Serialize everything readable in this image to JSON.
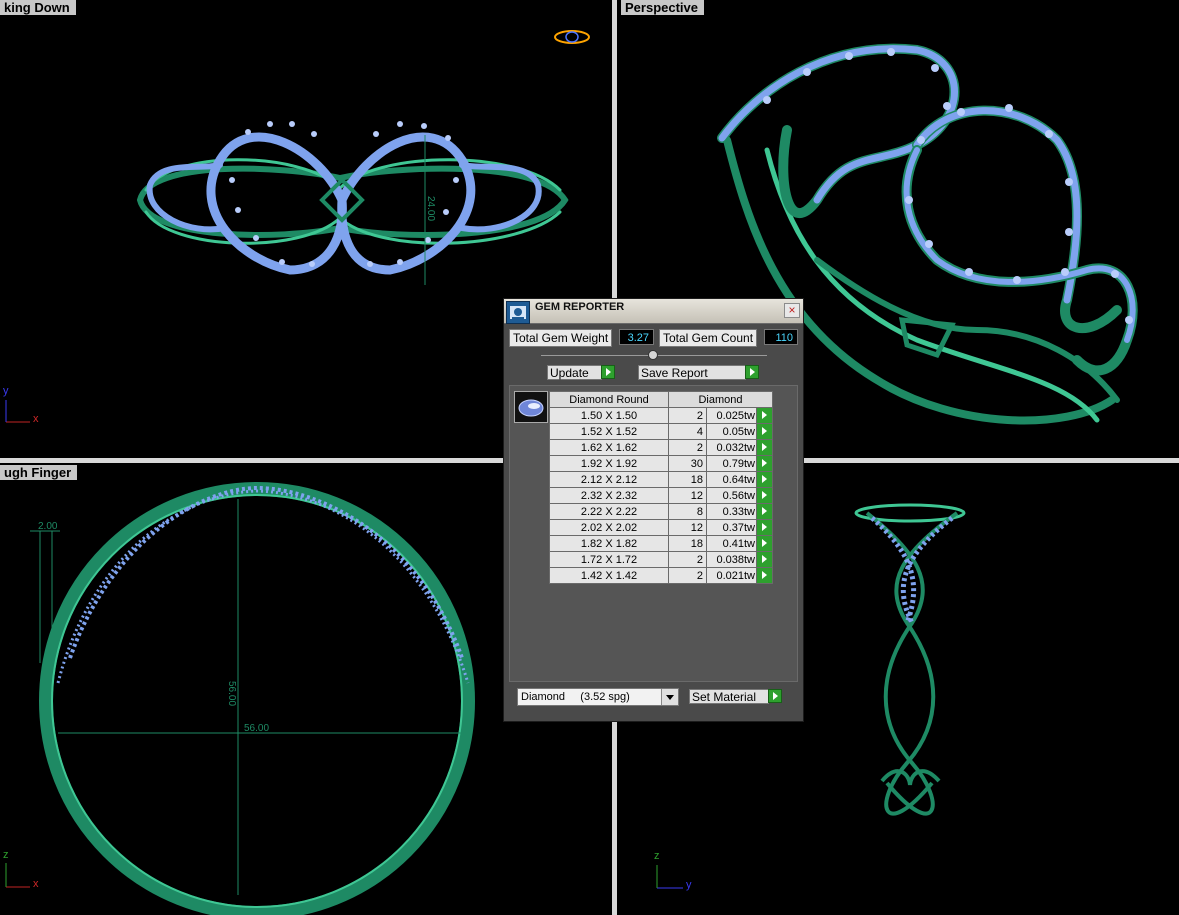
{
  "viewports": {
    "top_left_label": "king Down",
    "top_right_label": "Perspective",
    "bottom_left_label": "ugh Finger",
    "top_left_dim": "24.00",
    "bottom_left_dim_width": "2.00",
    "bottom_left_dim_height": "56.00",
    "bottom_left_dim_diameter": "56.00",
    "axes": {
      "x": "x",
      "y": "y",
      "z": "z"
    }
  },
  "gem_reporter": {
    "title": "GEM REPORTER",
    "close": "×",
    "total_weight_label": "Total Gem Weight",
    "total_weight_value": "3.27",
    "total_count_label": "Total Gem Count",
    "total_count_value": "110",
    "update_label": "Update",
    "save_report_label": "Save Report",
    "table_header_shape": "Diamond Round",
    "table_header_material": "Diamond",
    "rows": [
      {
        "size": "1.50 X 1.50",
        "count": "2",
        "weight": "0.025tw"
      },
      {
        "size": "1.52 X 1.52",
        "count": "4",
        "weight": "0.05tw"
      },
      {
        "size": "1.62 X 1.62",
        "count": "2",
        "weight": "0.032tw"
      },
      {
        "size": "1.92 X 1.92",
        "count": "30",
        "weight": "0.79tw"
      },
      {
        "size": "2.12 X 2.12",
        "count": "18",
        "weight": "0.64tw"
      },
      {
        "size": "2.32 X 2.32",
        "count": "12",
        "weight": "0.56tw"
      },
      {
        "size": "2.22 X 2.22",
        "count": "8",
        "weight": "0.33tw"
      },
      {
        "size": "2.02 X 2.02",
        "count": "12",
        "weight": "0.37tw"
      },
      {
        "size": "1.82 X 1.82",
        "count": "18",
        "weight": "0.41tw"
      },
      {
        "size": "1.72 X 1.72",
        "count": "2",
        "weight": "0.038tw"
      },
      {
        "size": "1.42 X 1.42",
        "count": "2",
        "weight": "0.021tw"
      }
    ],
    "material_select": "Diamond     (3.52 spg)",
    "set_material_label": "Set Material"
  },
  "colors": {
    "metal": "#1e8a64",
    "metal_highlight": "#3fc794",
    "gem": "#7fa3ee",
    "gem_highlight": "#b9cdfb",
    "label_bg": "#c8c8c8",
    "dialog_bg": "#4a4a4a",
    "value_text": "#4ad7ff",
    "go_button": "#2ea02e"
  },
  "icons": [
    "gem-reporter-logo-icon",
    "close-icon",
    "diamond-round-icon",
    "play-arrow-icon",
    "dropdown-arrow-icon",
    "slider-handle-icon"
  ]
}
